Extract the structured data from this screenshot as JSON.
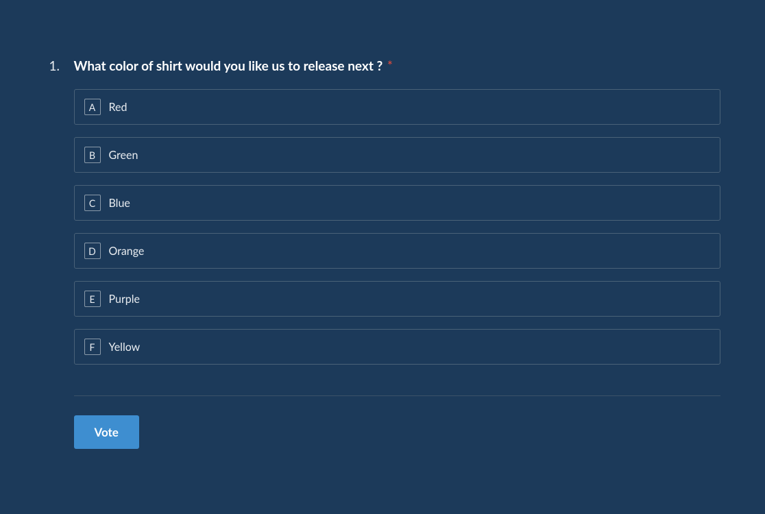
{
  "question": {
    "number": "1.",
    "text": "What color of shirt would you like us to release next ?",
    "required": true,
    "options": [
      {
        "key": "A",
        "label": "Red"
      },
      {
        "key": "B",
        "label": "Green"
      },
      {
        "key": "C",
        "label": "Blue"
      },
      {
        "key": "D",
        "label": "Orange"
      },
      {
        "key": "E",
        "label": "Purple"
      },
      {
        "key": "F",
        "label": "Yellow"
      }
    ]
  },
  "actions": {
    "vote_label": "Vote"
  }
}
